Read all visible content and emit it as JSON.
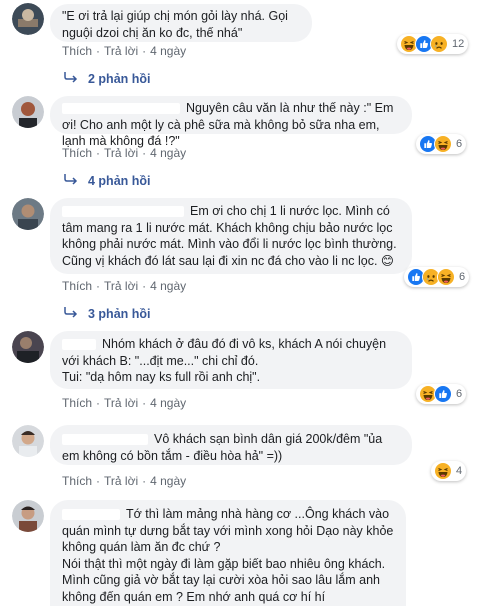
{
  "colors": {
    "accent": "#385898",
    "bubble": "#f2f3f5",
    "meta": "#606770",
    "haha": "#f7b125",
    "like": "#1877f2",
    "love": "#f33e58"
  },
  "action_labels": {
    "like": "Thích",
    "reply": "Trả lời"
  },
  "comments": [
    {
      "text": "\"E ơi trả lại giúp chị món gỏi lày nhá. Gọi nguội dzoi chị ăn ko đc, thế nhá\"",
      "time": "4 ngày",
      "reactions": [
        "haha-icon",
        "like-icon",
        "sad-icon"
      ],
      "count": "12",
      "replies": "2 phản hồi"
    },
    {
      "text": "Nguyên câu văn là như thế này :\" Em ơi! Cho anh một ly cà phê sữa mà không bỏ sữa nha em, lạnh mà không đá !?\"",
      "time": "4 ngày",
      "reactions": [
        "like-icon",
        "haha-icon"
      ],
      "count": "6",
      "replies": "4 phản hồi"
    },
    {
      "text": "Em ơi cho chị 1 li nước lọc. Mình có tâm mang ra 1 li nước mát. Khách không chịu bảo nước lọc không phải nước mát. Mình vào đổi li nước lọc bình thường. Cũng vị khách đó lát sau lại đi xin nc đá cho vào li nc lọc. 😊",
      "time": "4 ngày",
      "reactions": [
        "like-icon",
        "sad-icon",
        "haha-icon"
      ],
      "count": "6",
      "replies": "3 phản hồi"
    },
    {
      "text": "Nhóm khách ở đâu đó đi vô ks, khách A nói chuyện với khách B: \"...địt me...\" chi chỉ đó.\nTui: \"dạ hôm nay ks full rồi anh chị\".",
      "time": "4 ngày",
      "reactions": [
        "haha-icon",
        "like-icon"
      ],
      "count": "6",
      "replies": ""
    },
    {
      "text": "Vô khách sạn bình dân giá 200k/đêm \"ủa em không có bồn tắm - điều hòa hả\" =))",
      "time": "4 ngày",
      "reactions": [
        "haha-icon"
      ],
      "count": "4",
      "replies": ""
    },
    {
      "text": "Tớ thì làm mảng nhà hàng cơ ...Ông khách vào quán mình tự dưng bắt tay với mình xong hỏi Dạo này khỏe không quán làm ăn đc chứ ?\nNói thật thì một ngày đi làm gặp biết bao nhiêu ông khách. Mình cũng giả vờ bắt tay lại cười xòa hỏi sao lâu lắm anh không đến quán em ? Em nhớ anh quá cơ hí hí",
      "time": "",
      "reactions": [],
      "count": "",
      "replies": ""
    }
  ]
}
